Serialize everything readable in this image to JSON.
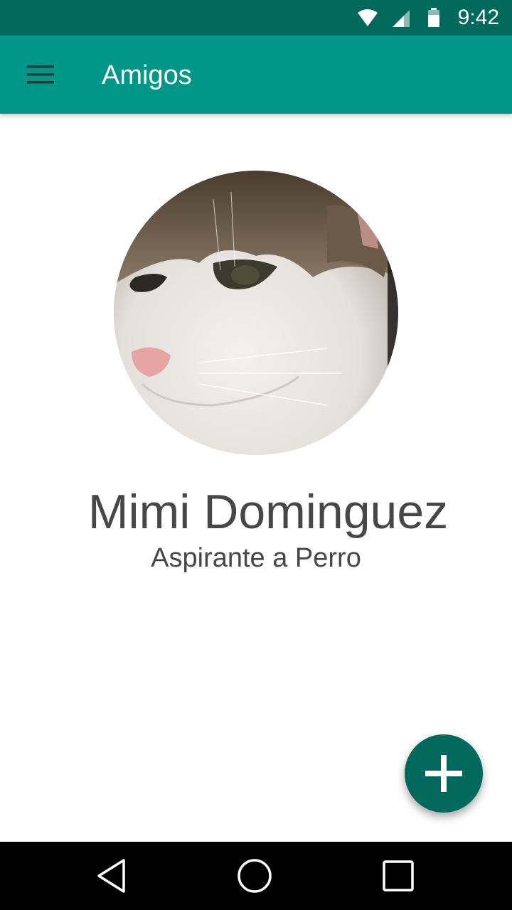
{
  "status_bar": {
    "time": "9:42",
    "icons": [
      "wifi-icon",
      "cellular-signal-icon",
      "battery-icon"
    ]
  },
  "app_bar": {
    "title": "Amigos",
    "menu_icon": "hamburger-menu-icon"
  },
  "profile": {
    "name": "Mimi Dominguez",
    "subtitle": "Aspirante a Perro",
    "avatar": "cat-photo"
  },
  "fab": {
    "icon": "plus-icon"
  },
  "navigation_bar": {
    "buttons": [
      "back-icon",
      "home-icon",
      "recents-icon"
    ]
  },
  "colors": {
    "status_bar": "#00695c",
    "app_bar": "#009688",
    "fab": "#00695c",
    "text": "#474747"
  }
}
